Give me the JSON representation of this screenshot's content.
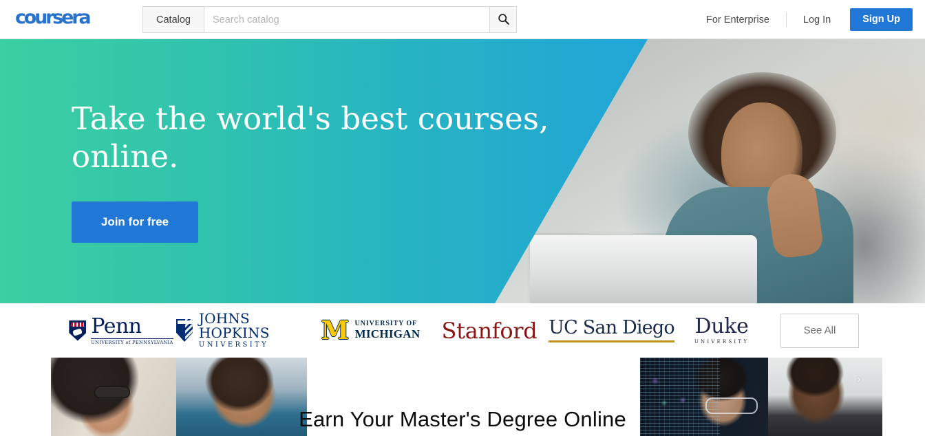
{
  "header": {
    "logo_text": "coursera",
    "logo_color": "#2a73cc",
    "catalog_label": "Catalog",
    "search": {
      "value": "",
      "placeholder": "Search catalog",
      "icon": "search-icon"
    },
    "for_enterprise_label": "For Enterprise",
    "log_in_label": "Log In",
    "sign_up_label": "Sign Up",
    "sign_up_color": "#2177d6"
  },
  "hero": {
    "title_line1": "Take the world's best courses,",
    "title_line2": "online.",
    "cta_label": "Join for free",
    "cta_color": "#2177d6",
    "gradient_start": "#3ccfa1",
    "gradient_end": "#1fa0e2"
  },
  "partners": {
    "see_all_label": "See All",
    "items": [
      {
        "id": "penn",
        "name": "Penn",
        "subtitle": "UNIVERSITY of PENNSYLVANIA",
        "color": "#011f5b"
      },
      {
        "id": "johns-hopkins",
        "name": "JOHNS HOPKINS",
        "subtitle": "UNIVERSITY",
        "color": "#002d72"
      },
      {
        "id": "michigan",
        "name": "MICHIGAN",
        "subtitle": "UNIVERSITY OF",
        "mark": "M",
        "color": "#00274c",
        "mark_color": "#ffcb05"
      },
      {
        "id": "stanford",
        "name": "Stanford",
        "color": "#8c1515"
      },
      {
        "id": "uc-san-diego",
        "name": "UC San Diego",
        "color": "#182b49",
        "rule_color": "#c69214"
      },
      {
        "id": "duke",
        "name": "Duke",
        "subtitle": "UNIVERSITY",
        "color": "#23294b"
      }
    ]
  },
  "banner": {
    "title": "Earn Your Master's Degree Online",
    "next_arrow": "›",
    "photos_left": [
      "woman-with-sunglasses",
      "smiling-man-in-blue-blazer"
    ],
    "photos_right": [
      "person-with-glasses-and-code",
      "smiling-man-in-suit"
    ]
  }
}
